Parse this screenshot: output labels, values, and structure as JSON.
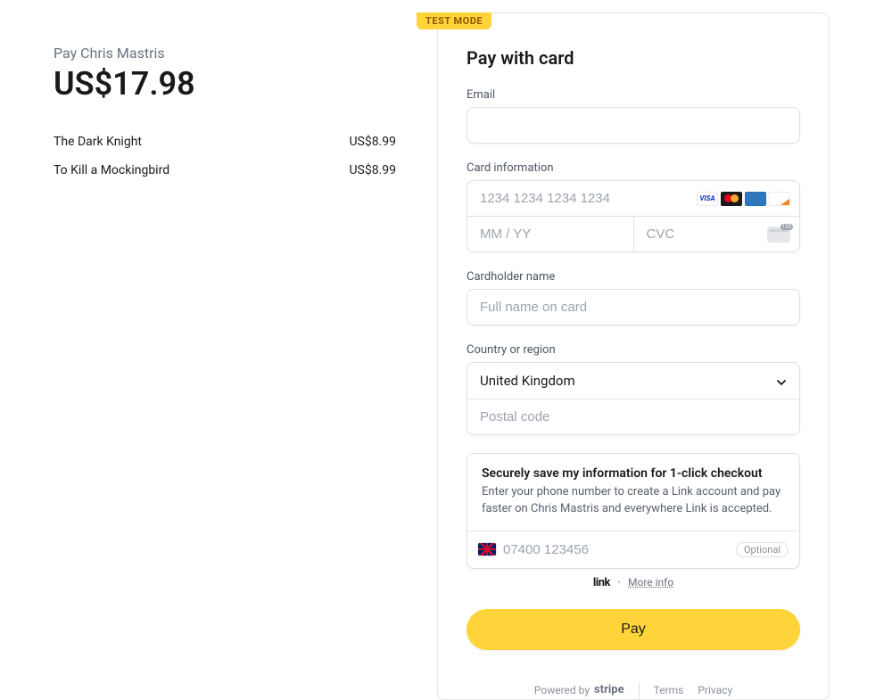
{
  "summary": {
    "pay_to": "Pay Chris Mastris",
    "total": "US$17.98",
    "items": [
      {
        "name": "The Dark Knight",
        "price": "US$8.99"
      },
      {
        "name": "To Kill a Mockingbird",
        "price": "US$8.99"
      }
    ]
  },
  "badge": {
    "test_mode": "TEST MODE"
  },
  "form": {
    "title": "Pay with card",
    "email": {
      "label": "Email"
    },
    "card": {
      "label": "Card information",
      "number_placeholder": "1234 1234 1234 1234",
      "expiry_placeholder": "MM / YY",
      "cvc_placeholder": "CVC"
    },
    "name": {
      "label": "Cardholder name",
      "placeholder": "Full name on card"
    },
    "country": {
      "label": "Country or region",
      "selected": "United Kingdom",
      "postal_placeholder": "Postal code"
    },
    "save": {
      "title": "Securely save my information for 1-click checkout",
      "desc": "Enter your phone number to create a Link account and pay faster on Chris Mastris and everywhere Link is accepted.",
      "phone_placeholder": "07400 123456",
      "optional": "Optional"
    },
    "link_line": {
      "logo": "link",
      "more": "More info"
    },
    "pay_button": "Pay"
  },
  "footer": {
    "powered": "Powered by",
    "stripe": "stripe",
    "terms": "Terms",
    "privacy": "Privacy"
  }
}
